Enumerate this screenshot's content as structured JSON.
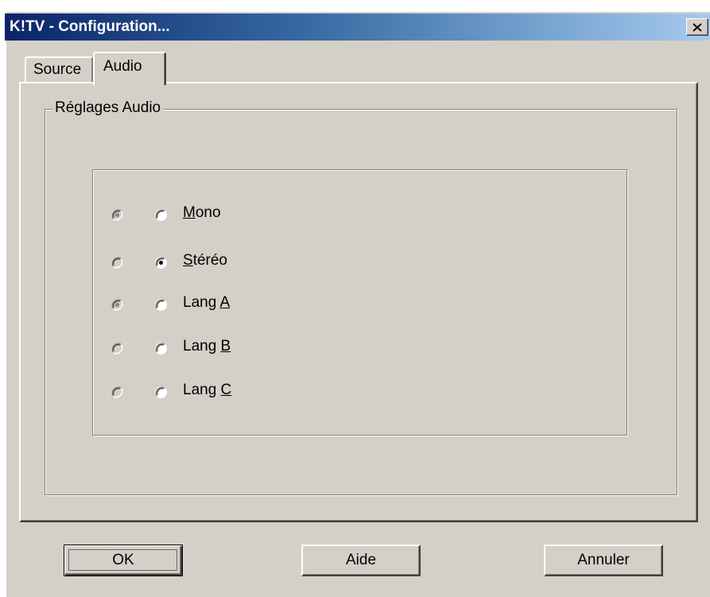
{
  "window": {
    "title": "K!TV - Configuration...",
    "close_label": "×"
  },
  "tabs": [
    {
      "label": "Source",
      "selected": false
    },
    {
      "label": "Audio",
      "selected": true
    }
  ],
  "group": {
    "label": "Réglages Audio"
  },
  "options": [
    {
      "label_pre": "",
      "label_u": "M",
      "label_post": "ono",
      "left_state": "checked-disabled",
      "right_state": "unchecked"
    },
    {
      "label_pre": "",
      "label_u": "S",
      "label_post": "téréo",
      "left_state": "unchecked-disabled",
      "right_state": "checked"
    },
    {
      "label_pre": "Lang ",
      "label_u": "A",
      "label_post": "",
      "left_state": "checked-disabled",
      "right_state": "unchecked"
    },
    {
      "label_pre": "Lang ",
      "label_u": "B",
      "label_post": "",
      "left_state": "unchecked-disabled",
      "right_state": "unchecked"
    },
    {
      "label_pre": "Lang ",
      "label_u": "C",
      "label_post": "",
      "left_state": "unchecked-disabled",
      "right_state": "unchecked"
    }
  ],
  "buttons": {
    "ok": "OK",
    "help": "Aide",
    "cancel": "Annuler"
  }
}
